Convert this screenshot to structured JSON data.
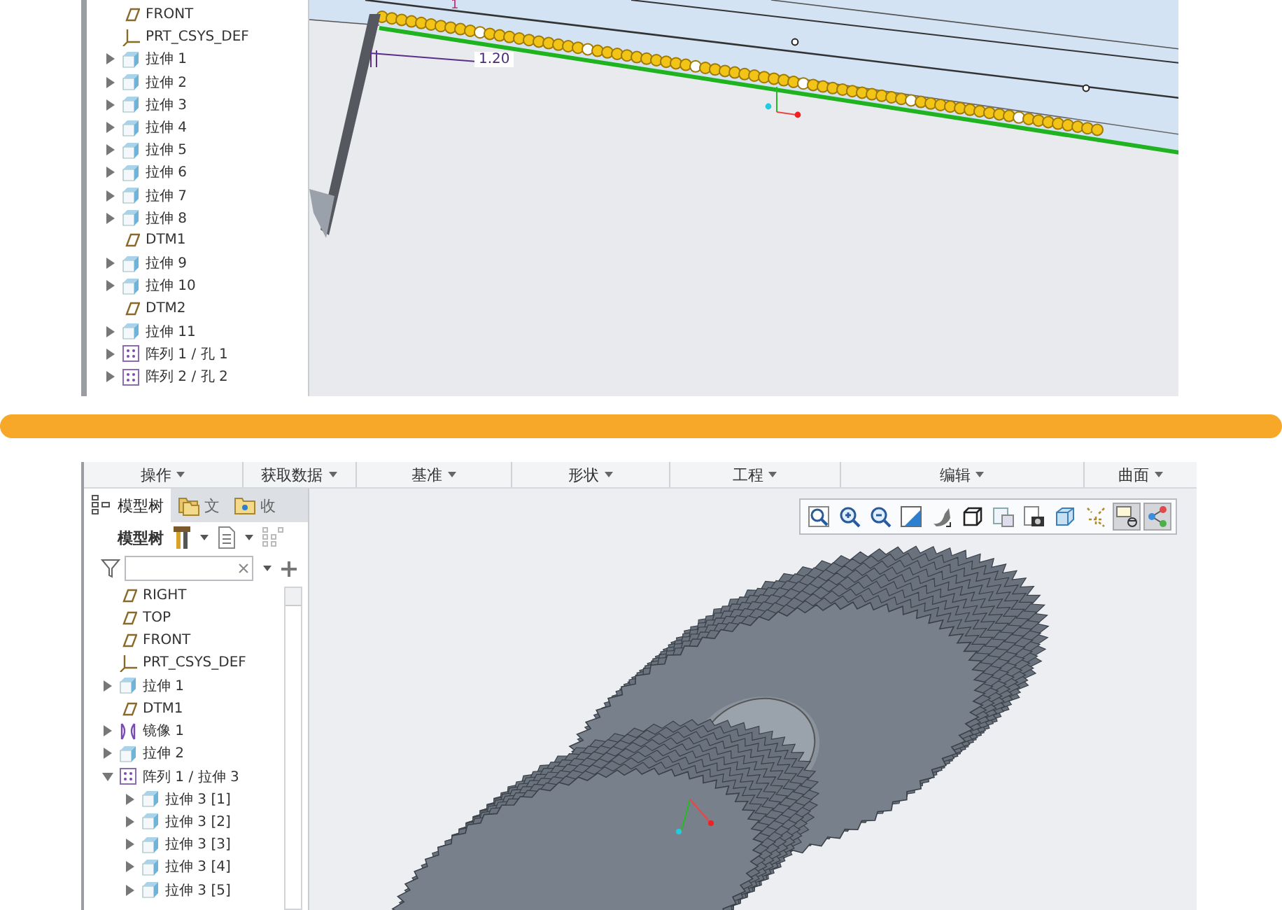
{
  "top_panel": {
    "model_tree": {
      "items": [
        {
          "kind": "datum",
          "label": "FRONT"
        },
        {
          "kind": "csys",
          "label": "PRT_CSYS_DEF"
        },
        {
          "kind": "extrude",
          "label": "拉伸 1",
          "expanded": false
        },
        {
          "kind": "extrude",
          "label": "拉伸 2",
          "expanded": false
        },
        {
          "kind": "extrude",
          "label": "拉伸 3",
          "expanded": false
        },
        {
          "kind": "extrude",
          "label": "拉伸 4",
          "expanded": false
        },
        {
          "kind": "extrude",
          "label": "拉伸 5",
          "expanded": false
        },
        {
          "kind": "extrude",
          "label": "拉伸 6",
          "expanded": false
        },
        {
          "kind": "extrude",
          "label": "拉伸 7",
          "expanded": false
        },
        {
          "kind": "extrude",
          "label": "拉伸 8",
          "expanded": false
        },
        {
          "kind": "datum",
          "label": "DTM1"
        },
        {
          "kind": "extrude",
          "label": "拉伸 9",
          "expanded": false
        },
        {
          "kind": "extrude",
          "label": "拉伸 10",
          "expanded": false
        },
        {
          "kind": "datum",
          "label": "DTM2"
        },
        {
          "kind": "extrude",
          "label": "拉伸 11",
          "expanded": false
        },
        {
          "kind": "pattern",
          "label": "阵列 1 / 孔 1",
          "expanded": false
        },
        {
          "kind": "pattern",
          "label": "阵列 2 / 孔 2",
          "expanded": false
        }
      ]
    },
    "view": {
      "dimension": "1.20",
      "edge_label": "1"
    }
  },
  "bottom_panel": {
    "ribbon": [
      {
        "label": "操作"
      },
      {
        "label": "获取数据"
      },
      {
        "label": "基准"
      },
      {
        "label": "形状"
      },
      {
        "label": "工程"
      },
      {
        "label": "编辑"
      },
      {
        "label": "曲面"
      }
    ],
    "tabs": [
      {
        "kind": "tree",
        "label": "模型树",
        "selected": true
      },
      {
        "kind": "folder",
        "label": "文",
        "selected": false
      },
      {
        "kind": "favorites",
        "label": "收",
        "selected": false
      }
    ],
    "tree_toolbar": {
      "title": "模型树"
    },
    "model_tree": {
      "items": [
        {
          "kind": "datum",
          "label": "RIGHT"
        },
        {
          "kind": "datum",
          "label": "TOP"
        },
        {
          "kind": "datum",
          "label": "FRONT"
        },
        {
          "kind": "csys",
          "label": "PRT_CSYS_DEF"
        },
        {
          "kind": "extrude",
          "label": "拉伸 1",
          "expanded": false
        },
        {
          "kind": "datum",
          "label": "DTM1"
        },
        {
          "kind": "mirror",
          "label": "镜像 1",
          "expanded": false
        },
        {
          "kind": "extrude",
          "label": "拉伸 2",
          "expanded": false
        },
        {
          "kind": "pattern",
          "label": "阵列 1 / 拉伸 3",
          "expanded": true,
          "children": [
            {
              "kind": "extrude",
              "label": "拉伸 3 [1]",
              "expanded": false
            },
            {
              "kind": "extrude",
              "label": "拉伸 3 [2]",
              "expanded": false
            },
            {
              "kind": "extrude",
              "label": "拉伸 3 [3]",
              "expanded": false
            },
            {
              "kind": "extrude",
              "label": "拉伸 3 [4]",
              "expanded": false
            },
            {
              "kind": "extrude",
              "label": "拉伸 3 [5]",
              "expanded": false
            }
          ]
        }
      ]
    },
    "view_toolbar": [
      {
        "kind": "refit",
        "on": false
      },
      {
        "kind": "zoom-in",
        "on": false
      },
      {
        "kind": "zoom-out",
        "on": false
      },
      {
        "kind": "repaint",
        "on": false
      },
      {
        "kind": "shading",
        "on": false
      },
      {
        "kind": "cube",
        "on": false
      },
      {
        "kind": "view-manager",
        "on": false
      },
      {
        "kind": "camera",
        "on": false
      },
      {
        "kind": "wire-cube",
        "on": false
      },
      {
        "kind": "datum-display",
        "on": false
      },
      {
        "kind": "annotation",
        "on": true
      },
      {
        "kind": "connector",
        "on": true
      }
    ]
  }
}
